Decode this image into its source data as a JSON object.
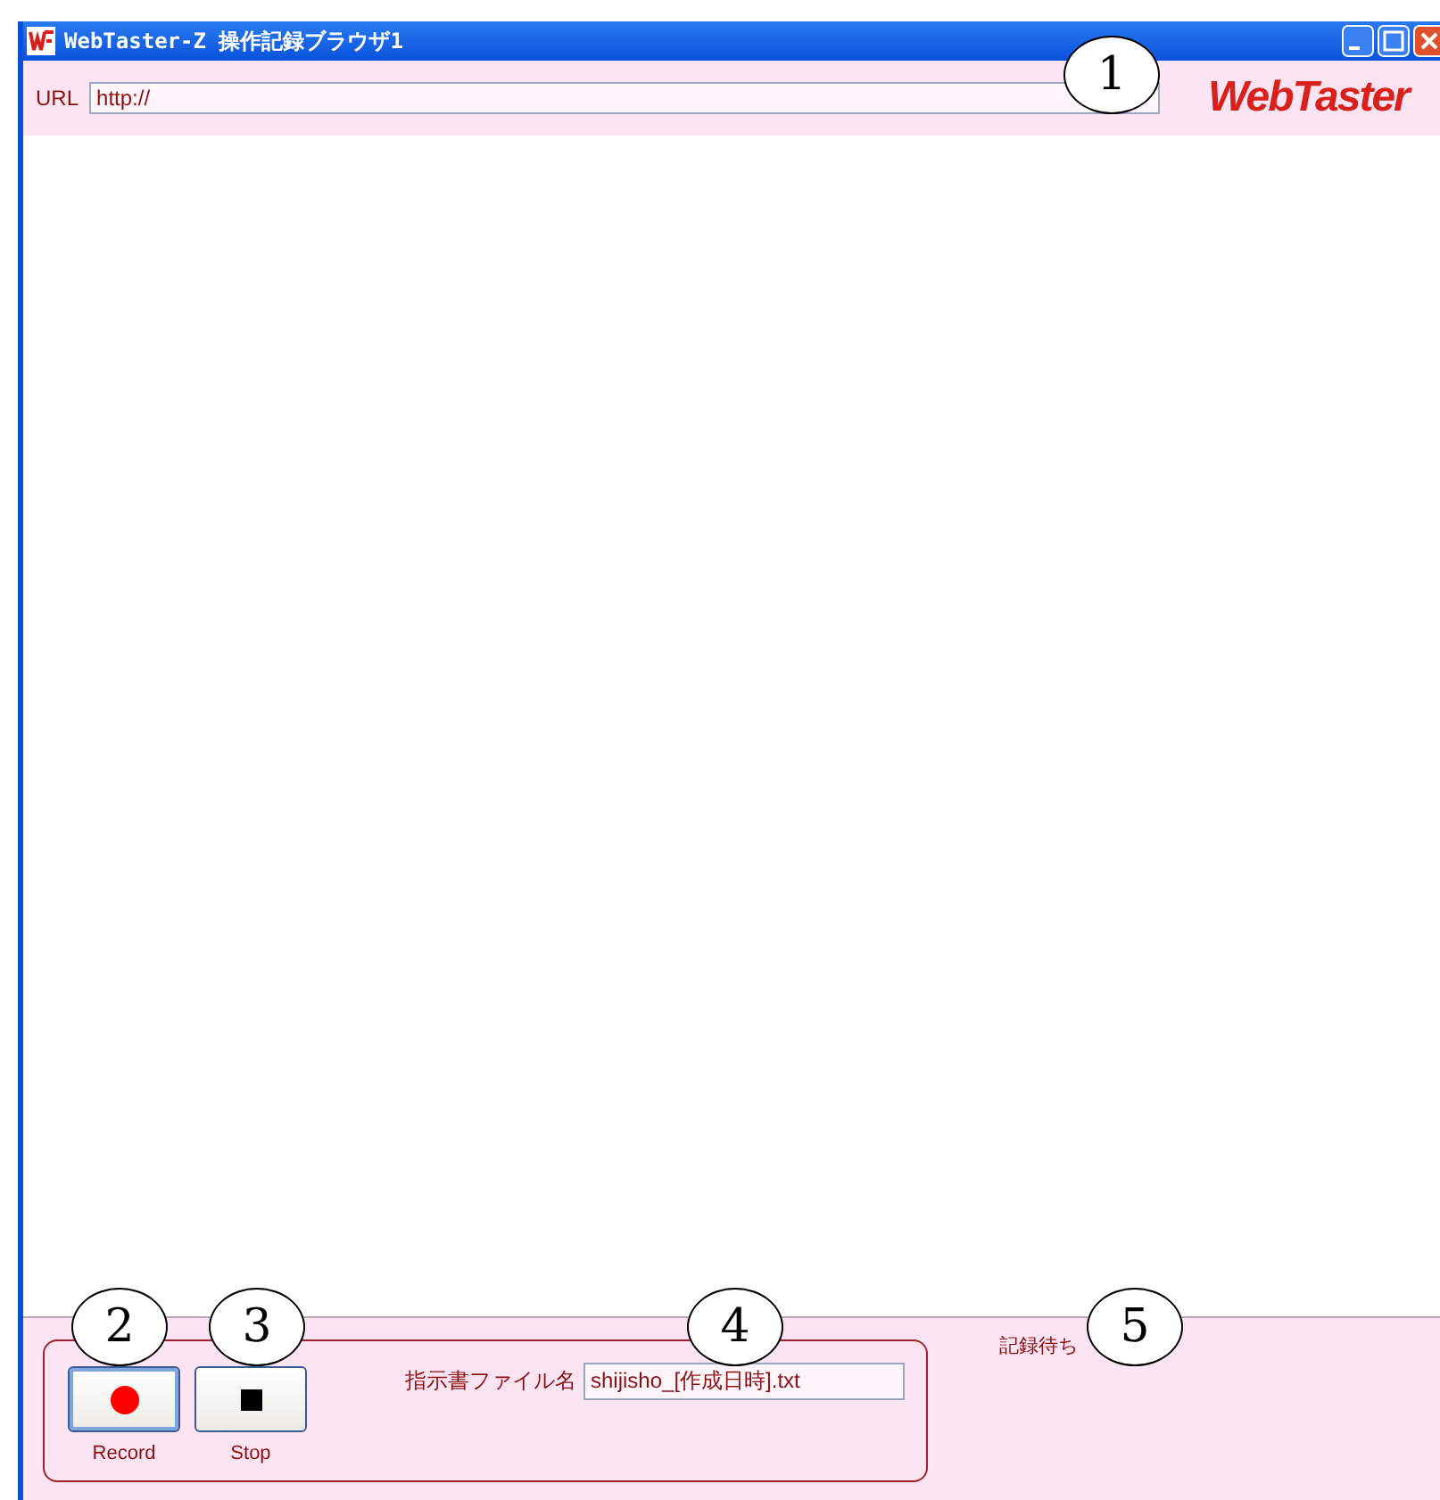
{
  "window": {
    "title": "WebTaster-Z 操作記録ブラウザ1",
    "logo": "WebTaster"
  },
  "url_bar": {
    "label": "URL",
    "value": "http://"
  },
  "controls": {
    "buttons": [
      {
        "kind": "record",
        "label": "Record",
        "focused": true
      },
      {
        "kind": "stop",
        "label": "Stop",
        "focused": false
      }
    ],
    "file_label": "指示書ファイル名",
    "file_value": "shijisho_[作成日時].txt",
    "status": "記録待ち"
  },
  "callouts": [
    "1",
    "2",
    "3",
    "4",
    "5"
  ]
}
